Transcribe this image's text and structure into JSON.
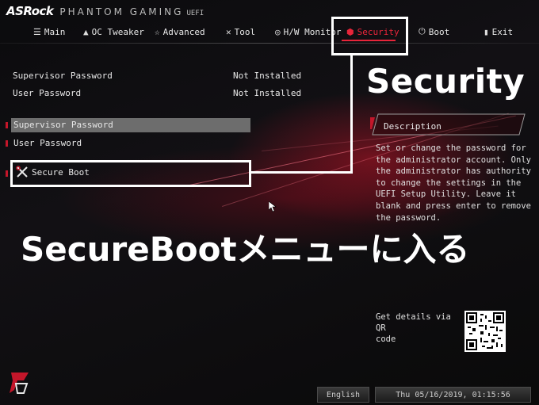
{
  "brand": {
    "name": "ASRock",
    "line": "PHANTOM GAMING",
    "suffix": "UEFI"
  },
  "tabs": [
    {
      "label": "Main",
      "icon": "list-icon"
    },
    {
      "label": "OC Tweaker",
      "icon": "rocket-icon"
    },
    {
      "label": "Advanced",
      "icon": "star-icon"
    },
    {
      "label": "Tool",
      "icon": "tools-icon"
    },
    {
      "label": "H/W Monitor",
      "icon": "gauge-icon"
    },
    {
      "label": "Security",
      "icon": "shield-icon",
      "active": true
    },
    {
      "label": "Boot",
      "icon": "power-icon"
    },
    {
      "label": "Exit",
      "icon": "exit-door-icon"
    }
  ],
  "status": [
    {
      "label": "Supervisor Password",
      "value": "Not Installed"
    },
    {
      "label": "User Password",
      "value": "Not Installed"
    }
  ],
  "menu": {
    "items": [
      {
        "label": "Supervisor Password",
        "selected": true
      },
      {
        "label": "User Password"
      }
    ],
    "secure_boot": {
      "label": "Secure Boot",
      "icon": "tools-icon"
    }
  },
  "overlays": {
    "security_caption": "Security",
    "main_caption": "SecureBootメニューに入る"
  },
  "description": {
    "title": "Description",
    "lines": [
      "Set or change the password for",
      "the administrator account. Only",
      "the administrator has authority",
      "to change the settings in the",
      "UEFI Setup Utility. Leave it",
      "blank and press enter to remove",
      "the password."
    ]
  },
  "qr": {
    "label_lines": [
      "Get details via QR",
      "code"
    ]
  },
  "footer": {
    "language": "English",
    "datetime": "Thu 05/16/2019, 01:15:56"
  },
  "colors": {
    "accent": "#e8253a",
    "selected_row": "#6d6d6d",
    "annotation": "#ffffff"
  }
}
